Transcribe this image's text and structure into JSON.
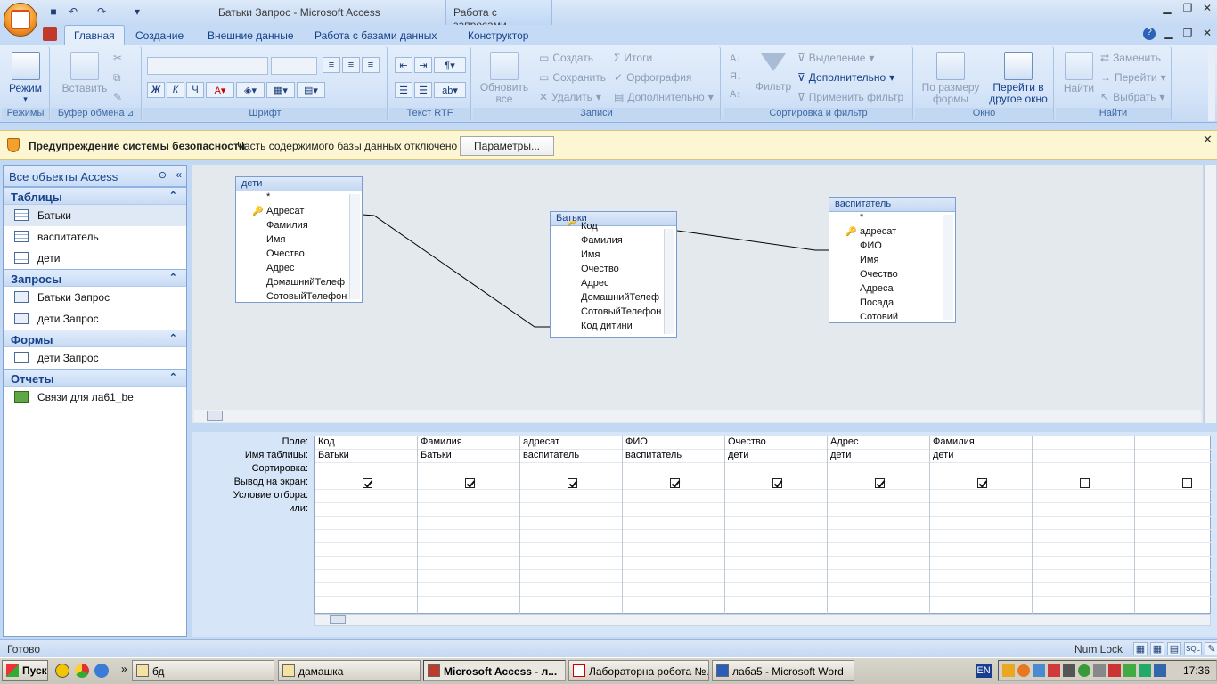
{
  "window": {
    "title": "Батьки Запрос - Microsoft Access",
    "context_tab": "Работа с запросами"
  },
  "tabs": [
    "Главная",
    "Создание",
    "Внешние данные",
    "Работа с базами данных",
    "Конструктор"
  ],
  "ribbon": {
    "views": {
      "label": "Режим",
      "group": "Режимы"
    },
    "clipboard": {
      "paste": "Вставить",
      "group": "Буфер обмена"
    },
    "font": {
      "group": "Шрифт",
      "bold": "Ж",
      "italic": "К",
      "underline": "Ч"
    },
    "rtf": {
      "group": "Текст RTF"
    },
    "records": {
      "refresh": "Обновить все",
      "create": "Создать",
      "save": "Сохранить",
      "delete": "Удалить",
      "totals": "Итоги",
      "spelling": "Орфография",
      "more": "Дополнительно",
      "group": "Записи"
    },
    "sort": {
      "filter": "Фильтр",
      "selection": "Выделение",
      "advanced": "Дополнительно",
      "apply": "Применить фильтр",
      "group": "Сортировка и фильтр"
    },
    "window": {
      "fit": "По размеру формы",
      "switch": "Перейти в другое окно",
      "group": "Окно"
    },
    "find": {
      "find": "Найти",
      "replace": "Заменить",
      "goto": "Перейти",
      "select": "Выбрать",
      "group": "Найти"
    }
  },
  "security": {
    "title": "Предупреждение системы безопасности",
    "message": "Часть содержимого базы данных отключено",
    "button": "Параметры..."
  },
  "nav": {
    "header": "Все объекты Access",
    "sections": [
      {
        "title": "Таблицы",
        "items": [
          "Батьки",
          "васпитатель",
          "дети"
        ]
      },
      {
        "title": "Запросы",
        "items": [
          "Батьки Запрос",
          "дети Запрос"
        ]
      },
      {
        "title": "Формы",
        "items": [
          "дети Запрос"
        ]
      },
      {
        "title": "Отчеты",
        "items": [
          "Связи для ла61_be"
        ]
      }
    ]
  },
  "tables": [
    {
      "name": "дети",
      "fields": [
        "*",
        "Адресат",
        "Фамилия",
        "Имя",
        "Очество",
        "Адрес",
        "ДомашнийТелеф",
        "СотовыйТелефон"
      ]
    },
    {
      "name": "Батьки",
      "fields": [
        "Код",
        "Фамилия",
        "Имя",
        "Очество",
        "Адрес",
        "ДомашнийТелеф",
        "СотовыйТелефон",
        "Код дитини"
      ]
    },
    {
      "name": "васпитатель",
      "fields": [
        "*",
        "адресат",
        "ФИО",
        "Имя",
        "Очество",
        "Адреса",
        "Посада",
        "Сотовий"
      ]
    }
  ],
  "grid": {
    "row_labels": [
      "Поле:",
      "Имя таблицы:",
      "Сортировка:",
      "Вывод на экран:",
      "Условие отбора:",
      "или:"
    ],
    "columns": [
      {
        "field": "Код",
        "table": "Батьки",
        "show": true
      },
      {
        "field": "Фамилия",
        "table": "Батьки",
        "show": true
      },
      {
        "field": "адресат",
        "table": "васпитатель",
        "show": true
      },
      {
        "field": "ФИО",
        "table": "васпитатель",
        "show": true
      },
      {
        "field": "Очество",
        "table": "дети",
        "show": true
      },
      {
        "field": "Адрес",
        "table": "дети",
        "show": true
      },
      {
        "field": "Фамилия",
        "table": "дети",
        "show": true
      },
      {
        "field": "",
        "table": "",
        "show": false
      },
      {
        "field": "",
        "table": "",
        "show": false
      }
    ]
  },
  "status": {
    "text": "Готово",
    "numlock": "Num Lock"
  },
  "taskbar": {
    "start": "Пуск",
    "items": [
      "бд",
      "дамашка",
      "Microsoft Access - л...",
      "Лабораторна робота №...",
      "лаба5 - Microsoft Word"
    ],
    "lang": "EN",
    "clock": "17:36"
  }
}
